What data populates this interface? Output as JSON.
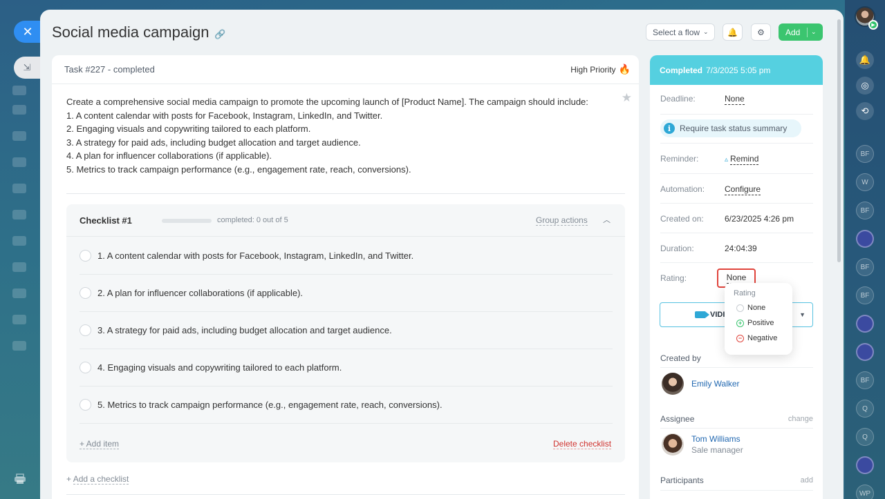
{
  "window": {
    "close_icon": "close-icon",
    "collapse_icon": "collapse-arrow-icon",
    "print_icon": "printer-icon"
  },
  "header": {
    "title": "Social media campaign",
    "select_flow": "Select a flow",
    "add": "Add"
  },
  "task": {
    "id_status": "Task #227 - completed",
    "priority": "High Priority",
    "description": [
      "Create a comprehensive social media campaign to promote the upcoming launch of [Product Name]. The campaign should include:",
      "1. A content calendar with posts for Facebook, Instagram, LinkedIn, and Twitter.",
      "2. Engaging visuals and copywriting tailored to each platform.",
      "3. A strategy for paid ads, including budget allocation and target audience.",
      "4. A plan for influencer collaborations (if applicable).",
      "5. Metrics to track campaign performance (e.g., engagement rate, reach, conversions)."
    ]
  },
  "checklist": {
    "title": "Checklist #1",
    "completed_fraction": 0.0,
    "count_text": "completed: 0 out of 5",
    "group_actions": "Group actions",
    "items": [
      "1. A content calendar with posts for Facebook, Instagram, LinkedIn, and Twitter.",
      "2. A plan for influencer collaborations (if applicable).",
      "3. A strategy for paid ads, including budget allocation and target audience.",
      "4. Engaging visuals and copywriting tailored to each platform.",
      "5. Metrics to track campaign performance (e.g., engagement rate, reach, conversions)."
    ],
    "add_item": "+ Add item",
    "delete": "Delete checklist",
    "add_checklist_prefix": "+ ",
    "add_checklist": "Add a checklist"
  },
  "sidebar": {
    "status": "Completed",
    "status_time": "7/3/2025 5:05 pm",
    "deadline_label": "Deadline:",
    "deadline_value": "None",
    "summary": "Require task status summary",
    "reminder_label": "Reminder:",
    "reminder_value": "Remind",
    "automation_label": "Automation:",
    "automation_value": "Configure",
    "created_on_label": "Created on:",
    "created_on_value": "6/23/2025 4:26 pm",
    "duration_label": "Duration:",
    "duration_value": "24:04:39",
    "rating_label": "Rating:",
    "rating_value": "None",
    "video_label": "VIDI",
    "created_by_label": "Created by",
    "creator_name": "Emily Walker",
    "assignee_label": "Assignee",
    "assignee_change": "change",
    "assignee_name": "Tom Williams",
    "assignee_role": "Sale manager",
    "participants_label": "Participants",
    "participants_add": "add"
  },
  "rating_popup": {
    "title": "Rating",
    "options": [
      "None",
      "Positive",
      "Negative"
    ]
  },
  "rail": {
    "chips": [
      "BF",
      "W",
      "BF",
      "",
      "BF",
      "BF",
      "",
      "",
      "BF",
      "Q",
      "Q",
      "",
      "WP"
    ]
  },
  "colors": {
    "accent": "#2f8ef2",
    "success": "#3bc56f",
    "status_header": "#55d0e0",
    "danger": "#e0433b",
    "link": "#2067b0"
  }
}
